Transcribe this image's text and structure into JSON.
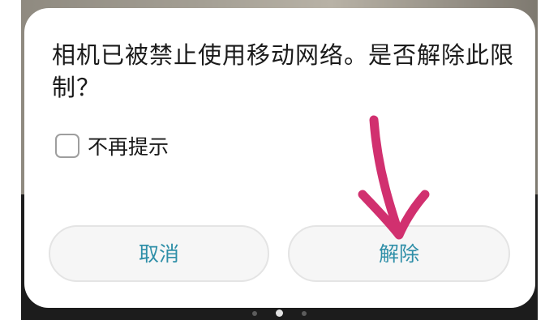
{
  "dialog": {
    "message": "相机已被禁止使用移动网络。是否解除此限制？",
    "checkbox": {
      "label": "不再提示",
      "checked": false
    },
    "buttons": {
      "cancel": "取消",
      "confirm": "解除"
    }
  },
  "pager": {
    "page_count": 3,
    "active_index": 1
  },
  "annotation": {
    "shape": "hand-drawn-arrow",
    "points_to": "confirm-button",
    "color": "#d1306f"
  },
  "colors": {
    "button_text": "#2f8fa8",
    "button_bg": "#f6f6f6",
    "dialog_bg": "#ffffff",
    "message_text": "#1a1a1a"
  }
}
